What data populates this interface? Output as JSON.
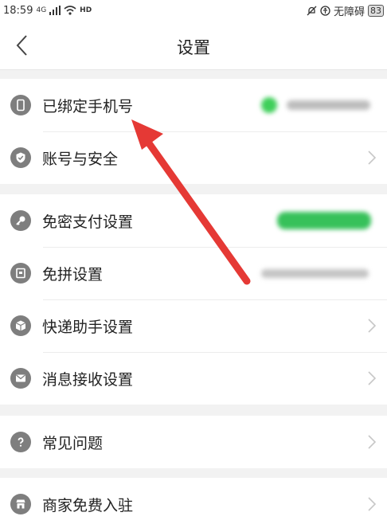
{
  "status_bar": {
    "time": "18:59",
    "network": "4G",
    "hd": "HD",
    "accessibility": "无障碍",
    "battery": "83"
  },
  "header": {
    "title": "设置"
  },
  "groups": [
    {
      "items": [
        {
          "label": "已绑定手机号",
          "icon": "phone-icon",
          "value_blurred": true
        },
        {
          "label": "账号与安全",
          "icon": "shield-icon",
          "chevron": true
        }
      ]
    },
    {
      "items": [
        {
          "label": "免密支付设置",
          "icon": "key-icon",
          "value_blurred": true
        },
        {
          "label": "免拼设置",
          "icon": "card-icon",
          "value_blurred": true
        },
        {
          "label": "快递助手设置",
          "icon": "package-icon",
          "chevron": true
        },
        {
          "label": "消息接收设置",
          "icon": "envelope-icon",
          "chevron": true
        }
      ]
    },
    {
      "items": [
        {
          "label": "常见问题",
          "icon": "question-icon",
          "chevron": true
        }
      ]
    },
    {
      "items": [
        {
          "label": "商家免费入驻",
          "icon": "shop-icon",
          "chevron": true
        }
      ]
    }
  ],
  "colors": {
    "icon_bg": "#7e7e7e",
    "green": "#34c759",
    "arrow": "#e53935"
  }
}
